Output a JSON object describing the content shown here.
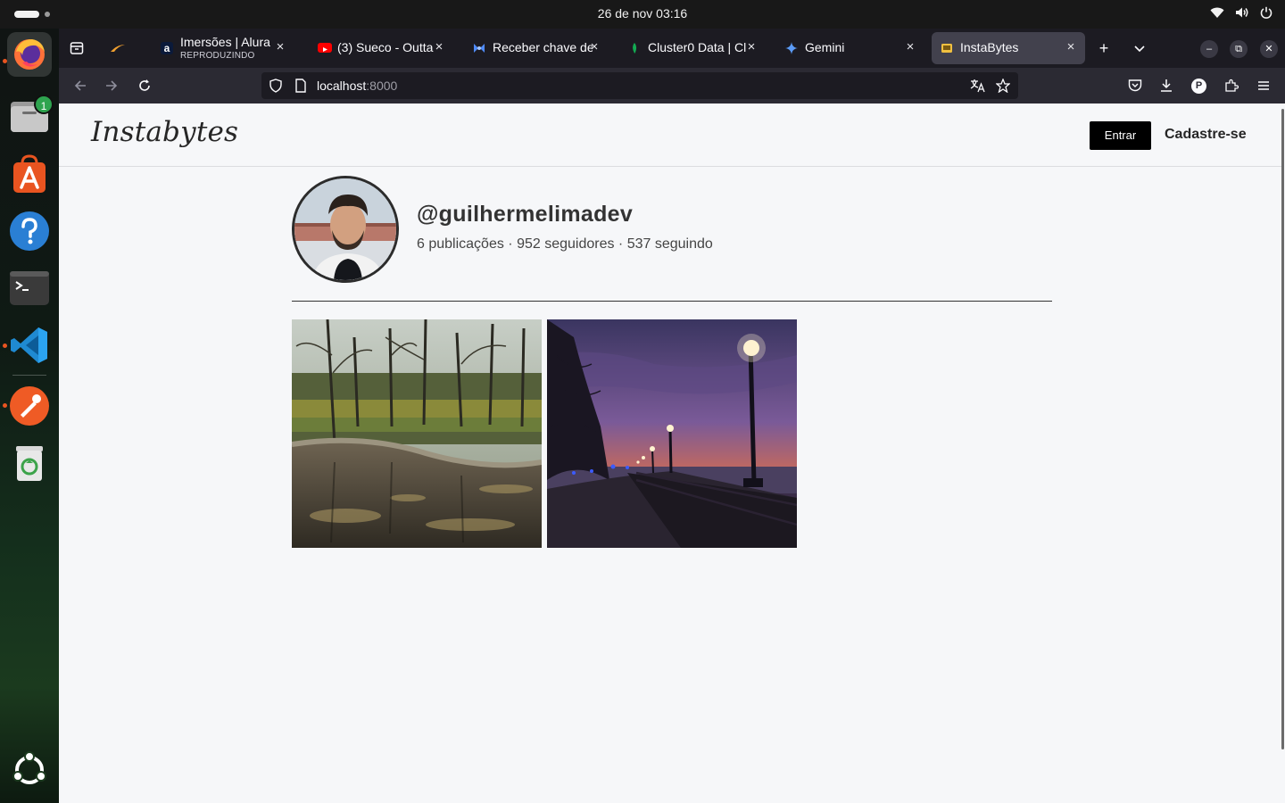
{
  "system": {
    "clock": "26 de nov  03:16",
    "dock": {
      "items": [
        "firefox",
        "files",
        "app-center",
        "help",
        "terminal",
        "vscode",
        "postman",
        "trash"
      ],
      "files_badge": "1"
    }
  },
  "browser": {
    "tabs": [
      {
        "title": "Imersões | Alura",
        "subtitle": "REPRODUZINDO",
        "favicon": "alura-icon"
      },
      {
        "title": "(3) Sueco - Outta",
        "favicon": "youtube-icon"
      },
      {
        "title": "Receber chave de",
        "favicon": "google-ai-studio-icon"
      },
      {
        "title": "Cluster0 Data | Cl",
        "favicon": "mongodb-icon"
      },
      {
        "title": "Gemini",
        "favicon": "gemini-icon"
      },
      {
        "title": "InstaBytes",
        "favicon": "instabytes-icon",
        "selected": true
      }
    ],
    "url": {
      "host": "localhost",
      "port": ":8000"
    },
    "profile_initial": "P"
  },
  "site": {
    "logo": "Instabytes",
    "login_label": "Entrar",
    "signup_label": "Cadastre-se",
    "profile": {
      "username": "@guilhermelimadev",
      "stats": "6 publicações · 952 seguidores · 537 seguindo"
    },
    "posts": [
      {
        "subject": "autumn-forest-pond"
      },
      {
        "subject": "twilight-waterfront-streetlamps"
      }
    ]
  },
  "colors": {
    "tabbar_bg": "#1c1b22",
    "navbar_bg": "#2b2a33",
    "page_bg": "#f6f7f9",
    "login_btn_bg": "#000000",
    "ubuntu_orange": "#e95420"
  }
}
